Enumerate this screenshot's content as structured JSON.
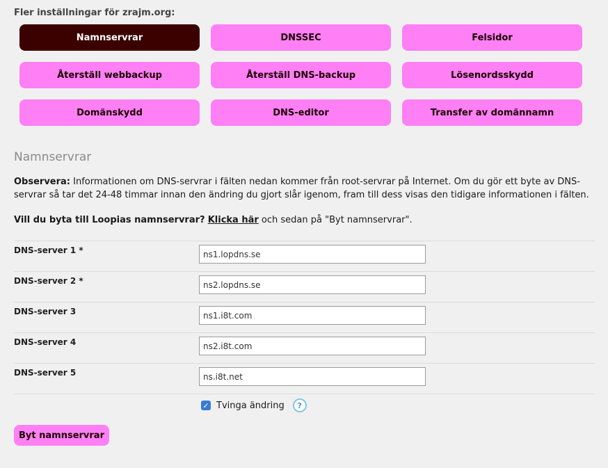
{
  "more_settings": {
    "heading": "Fler inställningar för zrajm.org:",
    "buttons": [
      {
        "label": "Namnservrar",
        "active": true
      },
      {
        "label": "DNSSEC"
      },
      {
        "label": "Felsidor"
      },
      {
        "label": "Återställ webbackup"
      },
      {
        "label": "Återställ DNS-backup"
      },
      {
        "label": "Lösenordsskydd"
      },
      {
        "label": "Domänskydd"
      },
      {
        "label": "DNS-editor"
      },
      {
        "label": "Transfer av domännamn"
      }
    ]
  },
  "section": {
    "title": "Namnservrar",
    "notice_label": "Observera:",
    "notice_text": "Informationen om DNS-servrar i fälten nedan kommer från root-servrar på Internet. Om du gör ett byte av DNS-servrar så tar det 24-48 timmar innan den ändring du gjort slår igenom, fram till dess visas den tidigare informationen i fälten.",
    "switch_question": "Vill du byta till Loopias namnservrar?",
    "switch_link": "Klicka här",
    "switch_rest": "och sedan på \"Byt namnservrar\"."
  },
  "dns_servers": [
    {
      "label": "DNS-server 1 *",
      "value": "ns1.lopdns.se"
    },
    {
      "label": "DNS-server 2 *",
      "value": "ns2.lopdns.se"
    },
    {
      "label": "DNS-server 3",
      "value": "ns1.i8t.com"
    },
    {
      "label": "DNS-server 4",
      "value": "ns2.i8t.com"
    },
    {
      "label": "DNS-server 5",
      "value": "ns.i8t.net"
    }
  ],
  "force_change": {
    "label": "Tvinga ändring",
    "checked": true,
    "help_symbol": "?"
  },
  "submit_label": "Byt namnservrar",
  "colors": {
    "accent": "#ff7ff5",
    "active": "#3b0000",
    "checkbox": "#3a7bd5"
  }
}
